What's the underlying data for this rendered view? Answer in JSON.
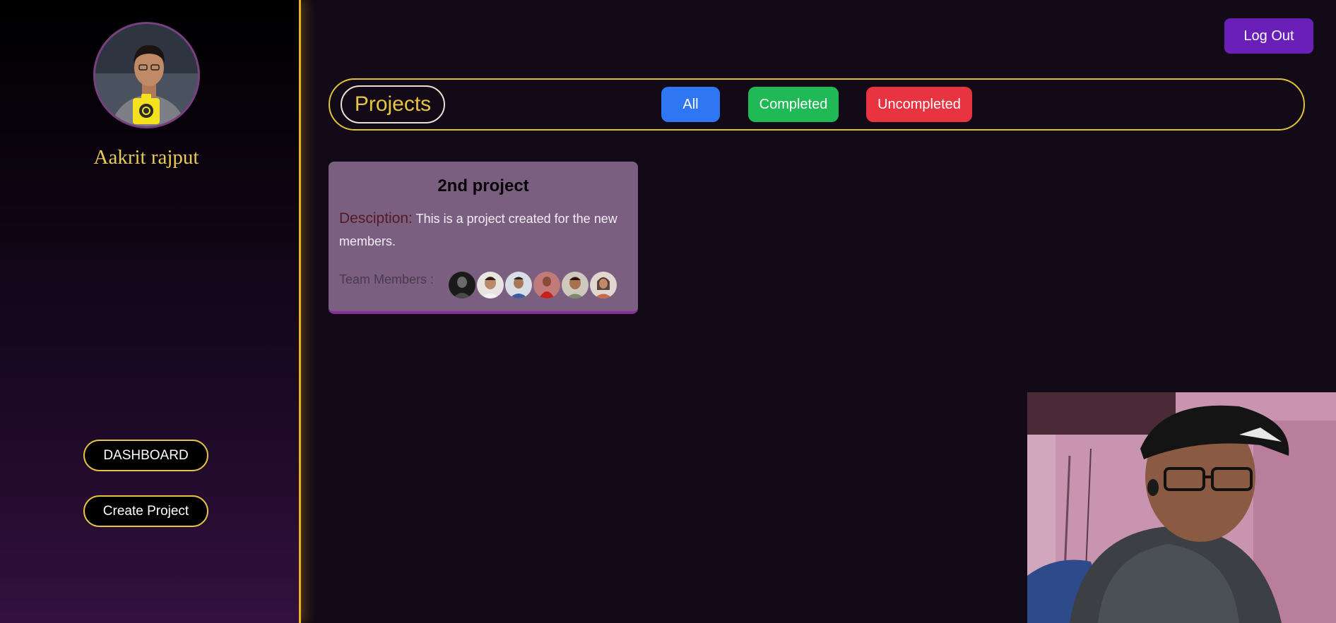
{
  "sidebar": {
    "user_name": "Aakrit rajput",
    "nav": {
      "dashboard_label": "DASHBOARD",
      "create_project_label": "Create Project"
    }
  },
  "header": {
    "logout_label": "Log Out"
  },
  "filter": {
    "section_label": "Projects",
    "options": {
      "all": "All",
      "completed": "Completed",
      "uncompleted": "Uncompleted"
    }
  },
  "projects": [
    {
      "title": "2nd project",
      "description_label": "Desciption:",
      "description": "This is a project created for the new members.",
      "team_label": "Team Members :",
      "member_count": 6
    }
  ],
  "icons": {
    "avatar": "user-avatar",
    "camera": "camera-icon"
  },
  "colors": {
    "accent_gold": "#e6c441",
    "logout_purple": "#6a1fb8",
    "all_blue": "#2f76f2",
    "completed_green": "#1fb955",
    "uncompleted_red": "#e83340",
    "card_bg": "#7a5f80"
  }
}
